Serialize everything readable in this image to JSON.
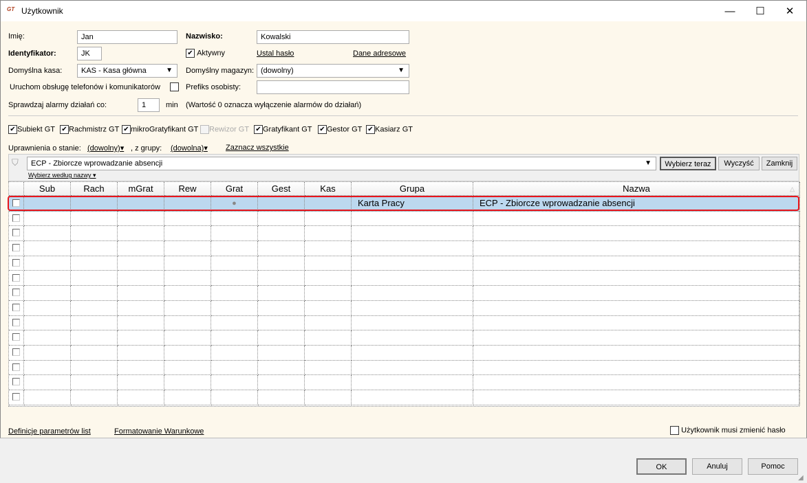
{
  "window": {
    "title": "Użytkownik",
    "app_icon": "GT",
    "minimize": "—",
    "maximize": "☐",
    "close": "✕"
  },
  "form": {
    "first_name_label": "Imię:",
    "first_name": "Jan",
    "last_name_label": "Nazwisko:",
    "last_name": "Kowalski",
    "id_label": "Identyfikator:",
    "id": "JK",
    "active_label": "Aktywny",
    "active": true,
    "set_password": "Ustal hasło",
    "address_data": "Dane adresowe",
    "cash_label": "Domyślna kasa:",
    "cash": "KAS - Kasa główna",
    "warehouse_label": "Domyślny magazyn:",
    "warehouse": "(dowolny)",
    "phones_label": "Uruchom obsługę telefonów i komunikatorów",
    "phones": false,
    "prefix_label": "Prefiks osobisty:",
    "prefix": "",
    "alarm_label": "Sprawdzaj alarmy działań co:",
    "alarm": "1",
    "alarm_unit": "min",
    "alarm_note": "(Wartość 0 oznacza wyłączenie alarmów do działań)"
  },
  "modules": [
    {
      "label": "Subiekt GT",
      "checked": true,
      "disabled": false
    },
    {
      "label": "Rachmistrz GT",
      "checked": true,
      "disabled": false
    },
    {
      "label": "mikroGratyfikant GT",
      "checked": true,
      "disabled": false
    },
    {
      "label": "Rewizor GT",
      "checked": false,
      "disabled": true
    },
    {
      "label": "Gratyfikant GT",
      "checked": true,
      "disabled": false
    },
    {
      "label": "Gestor GT",
      "checked": true,
      "disabled": false
    },
    {
      "label": "Kasiarz GT",
      "checked": true,
      "disabled": false
    }
  ],
  "filter": {
    "state_label": "Uprawnienia o stanie:",
    "state": "(dowolny)",
    "group_label": ", z grupy:",
    "group": "(dowolna)",
    "select_all": "Zaznacz wszystkie"
  },
  "search": {
    "value": "ECP - Zbiorcze wprowadzanie absencji",
    "mode": "Wybierz według nazwy",
    "choose_now": "Wybierz teraz",
    "clear": "Wyczyść",
    "close": "Zamknij"
  },
  "grid": {
    "columns": [
      "",
      "Sub",
      "Rach",
      "mGrat",
      "Rew",
      "Grat",
      "Gest",
      "Kas",
      "Grupa",
      "Nazwa"
    ],
    "rows": [
      {
        "checked": false,
        "Sub": "",
        "Rach": "",
        "mGrat": "",
        "Rew": "",
        "Grat": "●",
        "Gest": "",
        "Kas": "",
        "Grupa": "Karta Pracy",
        "Nazwa": "ECP - Zbiorcze wprowadzanie absencji",
        "selected": true
      },
      {},
      {},
      {},
      {},
      {},
      {},
      {},
      {},
      {},
      {},
      {},
      {},
      {}
    ]
  },
  "footer": {
    "param_defs": "Definicje parametrów list",
    "cond_format": "Formatowanie Warunkowe",
    "must_change_pw": "Użytkownik musi zmienić hasło",
    "must_change_pw_checked": false
  },
  "buttons": {
    "ok": "OK",
    "cancel": "Anuluj",
    "help": "Pomoc"
  }
}
